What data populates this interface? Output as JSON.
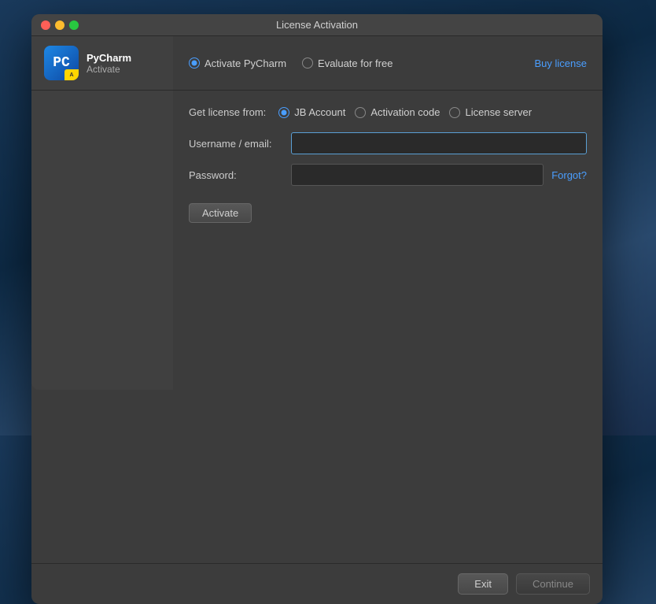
{
  "window": {
    "title": "License Activation",
    "trafficLights": [
      "close",
      "minimize",
      "maximize"
    ]
  },
  "logo": {
    "initials": "PC",
    "badge": "A",
    "title": "PyCharm",
    "subtitle": "Activate"
  },
  "topOptions": {
    "activateLabel": "Activate PyCharm",
    "evaluateLabel": "Evaluate for free",
    "buyLabel": "Buy license"
  },
  "licenseSource": {
    "label": "Get license from:",
    "options": [
      {
        "value": "jb_account",
        "label": "JB Account",
        "checked": true
      },
      {
        "value": "activation_code",
        "label": "Activation code",
        "checked": false
      },
      {
        "value": "license_server",
        "label": "License server",
        "checked": false
      }
    ]
  },
  "form": {
    "usernameLabel": "Username / email:",
    "passwordLabel": "Password:",
    "usernamePlaceholder": "",
    "passwordPlaceholder": "",
    "forgotLabel": "Forgot?",
    "activateLabel": "Activate"
  },
  "footer": {
    "exitLabel": "Exit",
    "continueLabel": "Continue"
  }
}
